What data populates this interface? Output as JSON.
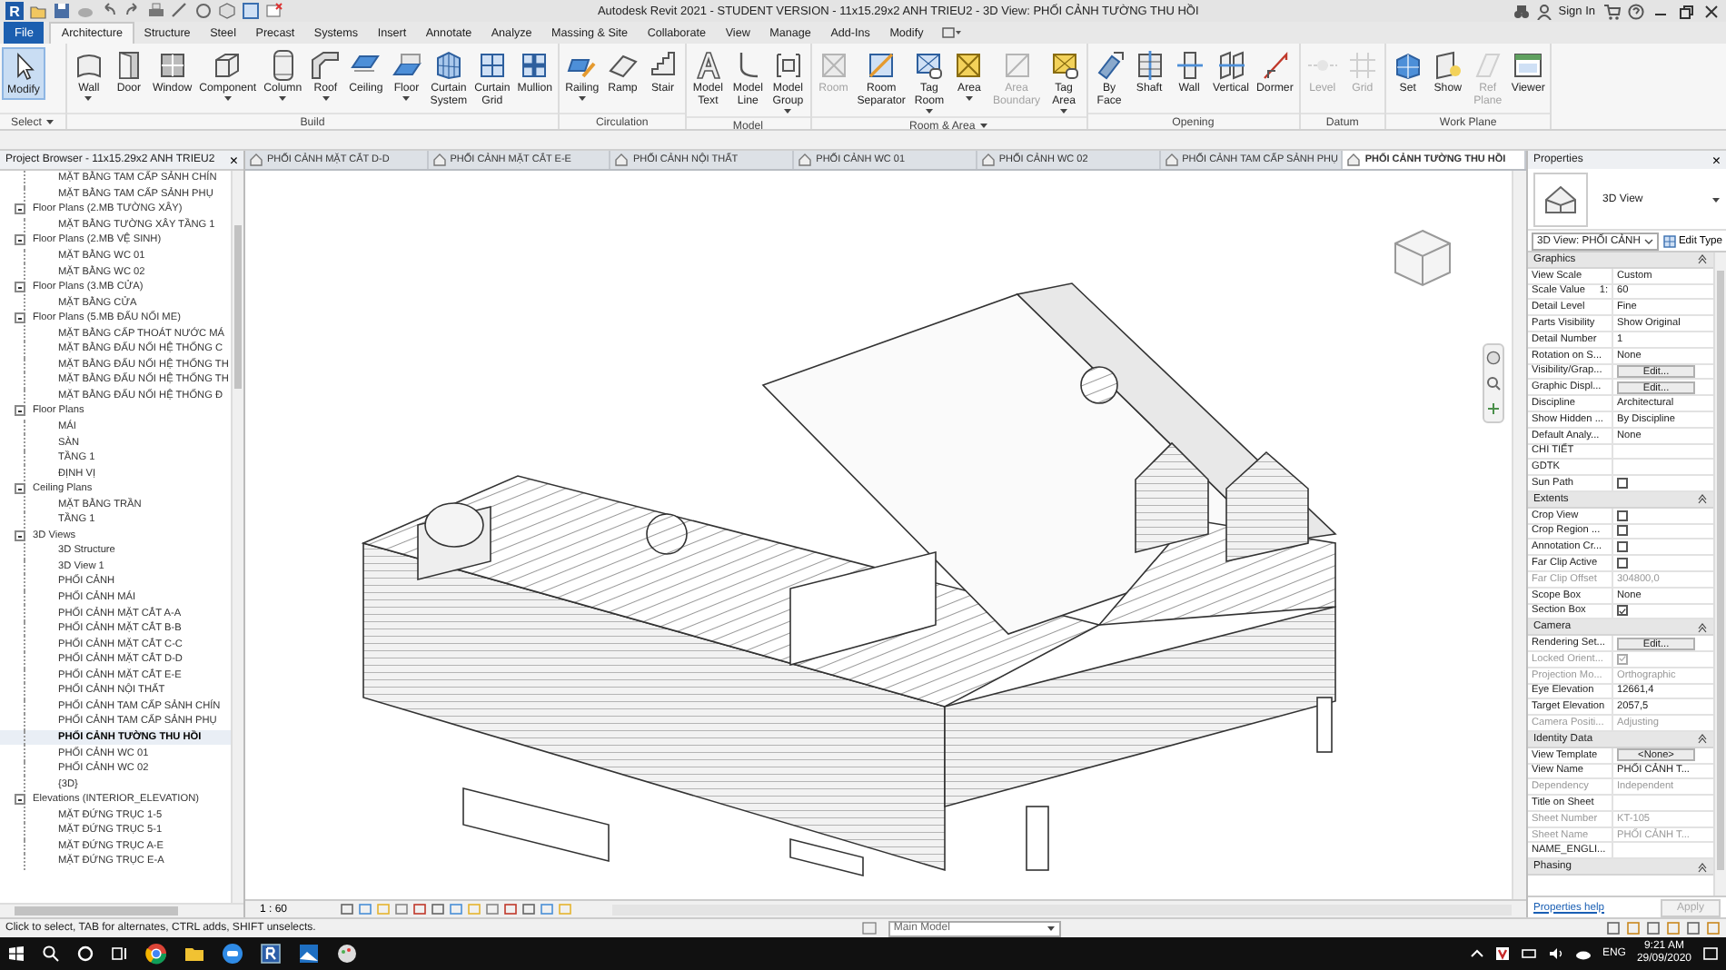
{
  "title_bar": {
    "app_logo": "R",
    "title": "Autodesk Revit 2021 - STUDENT VERSION - 11x15.29x2 ANH TRIEU2 - 3D View: PHỐI CẢNH TƯỜNG THU HỒI",
    "sign_in": "Sign In"
  },
  "ribbon": {
    "file_tab": "File",
    "tabs": [
      {
        "label": "Architecture",
        "selected": true
      },
      {
        "label": "Structure",
        "selected": false
      },
      {
        "label": "Steel",
        "selected": false
      },
      {
        "label": "Precast",
        "selected": false
      },
      {
        "label": "Systems",
        "selected": false
      },
      {
        "label": "Insert",
        "selected": false
      },
      {
        "label": "Annotate",
        "selected": false
      },
      {
        "label": "Analyze",
        "selected": false
      },
      {
        "label": "Massing & Site",
        "selected": false
      },
      {
        "label": "Collaborate",
        "selected": false
      },
      {
        "label": "View",
        "selected": false
      },
      {
        "label": "Manage",
        "selected": false
      },
      {
        "label": "Add-Ins",
        "selected": false
      },
      {
        "label": "Modify",
        "selected": false
      }
    ],
    "panels": [
      {
        "title": "Select",
        "has_menu": true,
        "tools": [
          {
            "label": "Modify",
            "active": true,
            "disabled": false
          }
        ]
      },
      {
        "title": "Build",
        "tools": [
          {
            "label": "Wall",
            "has_menu": true,
            "active": false,
            "disabled": false
          },
          {
            "label": "Door",
            "active": false,
            "disabled": false
          },
          {
            "label": "Window",
            "active": false,
            "disabled": false
          },
          {
            "label": "Component",
            "has_menu": true,
            "active": false,
            "disabled": false
          },
          {
            "label": "Column",
            "has_menu": true,
            "active": false,
            "disabled": false
          },
          {
            "label": "Roof",
            "has_menu": true,
            "active": false,
            "disabled": false
          },
          {
            "label": "Ceiling",
            "active": false,
            "disabled": false
          },
          {
            "label": "Floor",
            "has_menu": true,
            "active": false,
            "disabled": false
          },
          {
            "label": "Curtain System",
            "active": false,
            "disabled": false
          },
          {
            "label": "Curtain Grid",
            "active": false,
            "disabled": false
          },
          {
            "label": "Mullion",
            "active": false,
            "disabled": false
          }
        ]
      },
      {
        "title": "Circulation",
        "tools": [
          {
            "label": "Railing",
            "has_menu": true,
            "active": false,
            "disabled": false
          },
          {
            "label": "Ramp",
            "active": false,
            "disabled": false
          },
          {
            "label": "Stair",
            "active": false,
            "disabled": false
          }
        ]
      },
      {
        "title": "Model",
        "tools": [
          {
            "label": "Model Text",
            "active": false,
            "disabled": false
          },
          {
            "label": "Model Line",
            "active": false,
            "disabled": false
          },
          {
            "label": "Model Group",
            "has_menu": true,
            "active": false,
            "disabled": false
          }
        ]
      },
      {
        "title": "Room & Area",
        "has_menu": true,
        "tools": [
          {
            "label": "Room",
            "active": false,
            "disabled": true
          },
          {
            "label": "Room Separator",
            "active": false,
            "disabled": false
          },
          {
            "label": "Tag Room",
            "has_menu": true,
            "active": false,
            "disabled": false
          },
          {
            "label": "Area",
            "has_menu": true,
            "active": false,
            "disabled": false
          },
          {
            "label": "Area Boundary",
            "active": false,
            "disabled": true
          },
          {
            "label": "Tag Area",
            "has_menu": true,
            "active": false,
            "disabled": false
          }
        ]
      },
      {
        "title": "Opening",
        "tools": [
          {
            "label": "By Face",
            "active": false,
            "disabled": false
          },
          {
            "label": "Shaft",
            "active": false,
            "disabled": false
          },
          {
            "label": "Wall",
            "active": false,
            "disabled": false
          },
          {
            "label": "Vertical",
            "active": false,
            "disabled": false
          },
          {
            "label": "Dormer",
            "active": false,
            "disabled": false
          }
        ]
      },
      {
        "title": "Datum",
        "tools": [
          {
            "label": "Level",
            "active": false,
            "disabled": true
          },
          {
            "label": "Grid",
            "active": false,
            "disabled": true
          }
        ]
      },
      {
        "title": "Work Plane",
        "tools": [
          {
            "label": "Set",
            "active": false,
            "disabled": false
          },
          {
            "label": "Show",
            "active": false,
            "disabled": false
          },
          {
            "label": "Ref Plane",
            "active": false,
            "disabled": true
          },
          {
            "label": "Viewer",
            "active": false,
            "disabled": false
          }
        ]
      }
    ]
  },
  "project_browser": {
    "title": "Project Browser - 11x15.29x2 ANH TRIEU2",
    "close": "×",
    "items": [
      {
        "label": "MẶT BẰNG TAM CẤP SẢNH CHÍN",
        "selected": false
      },
      {
        "label": "MẶT BẰNG TAM CẤP SẢNH PHỤ",
        "selected": false
      },
      {
        "label": "Floor Plans (2.MB TƯỜNG XÂY)",
        "selected": false,
        "expanded": true,
        "children": [
          {
            "label": "MẶT BẰNG TƯỜNG XÂY TẦNG 1",
            "selected": false
          }
        ]
      },
      {
        "label": "Floor Plans (2.MB VỆ SINH)",
        "selected": false,
        "expanded": true,
        "children": [
          {
            "label": "MẶT BẰNG WC 01",
            "selected": false
          },
          {
            "label": "MẶT BẰNG WC 02",
            "selected": false
          }
        ]
      },
      {
        "label": "Floor Plans (3.MB CỬA)",
        "selected": false,
        "expanded": true,
        "children": [
          {
            "label": "MẶT BẰNG CỬA",
            "selected": false
          }
        ]
      },
      {
        "label": "Floor Plans (5.MB ĐẤU NỐI ME)",
        "selected": false,
        "expanded": true,
        "children": [
          {
            "label": "MẶT BẰNG CẤP THOÁT NƯỚC MÁ",
            "selected": false
          },
          {
            "label": "MẶT BẰNG ĐẤU NỐI HỆ THỐNG C",
            "selected": false
          },
          {
            "label": "MẶT BẰNG ĐẤU NỐI HỆ THỐNG TH",
            "selected": false
          },
          {
            "label": "MẶT BẰNG ĐẤU NỐI HỆ THỐNG TH",
            "selected": false
          },
          {
            "label": "MẶT BẰNG ĐẤU NỐI HỆ THỐNG Đ",
            "selected": false
          }
        ]
      },
      {
        "label": "Floor Plans",
        "selected": false,
        "expanded": true,
        "children": [
          {
            "label": "MÁI",
            "selected": false
          },
          {
            "label": "SÀN",
            "selected": false
          },
          {
            "label": "TẦNG 1",
            "selected": false
          },
          {
            "label": "ĐỊNH VỊ",
            "selected": false
          }
        ]
      },
      {
        "label": "Ceiling Plans",
        "selected": false,
        "expanded": true,
        "children": [
          {
            "label": "MẶT BẰNG TRẦN",
            "selected": false
          },
          {
            "label": "TẦNG 1",
            "selected": false
          }
        ]
      },
      {
        "label": "3D Views",
        "selected": false,
        "expanded": true,
        "children": [
          {
            "label": "3D Structure",
            "selected": false
          },
          {
            "label": "3D View 1",
            "selected": false
          },
          {
            "label": "PHỐI CẢNH",
            "selected": false
          },
          {
            "label": "PHỐI CẢNH MÁI",
            "selected": false
          },
          {
            "label": "PHỐI CẢNH MẶT CẮT A-A",
            "selected": false
          },
          {
            "label": "PHỐI CẢNH MẶT CẮT B-B",
            "selected": false
          },
          {
            "label": "PHỐI CẢNH MẶT CẮT C-C",
            "selected": false
          },
          {
            "label": "PHỐI CẢNH MẶT CẮT D-D",
            "selected": false
          },
          {
            "label": "PHỐI CẢNH MẶT CẮT E-E",
            "selected": false
          },
          {
            "label": "PHỐI CẢNH NỘI THẤT",
            "selected": false
          },
          {
            "label": "PHỐI CẢNH TAM CẤP SẢNH CHÍN",
            "selected": false
          },
          {
            "label": "PHỐI CẢNH TAM CẤP SẢNH PHỤ",
            "selected": false
          },
          {
            "label": "PHỐI CẢNH TƯỜNG THU HỒI",
            "selected": true
          },
          {
            "label": "PHỐI CẢNH WC 01",
            "selected": false
          },
          {
            "label": "PHỐI CẢNH WC 02",
            "selected": false
          },
          {
            "label": "{3D}",
            "selected": false
          }
        ]
      },
      {
        "label": "Elevations (INTERIOR_ELEVATION)",
        "selected": false,
        "expanded": true,
        "children": [
          {
            "label": "MẶT ĐỨNG TRỤC 1-5",
            "selected": false
          },
          {
            "label": "MẶT ĐỨNG TRỤC 5-1",
            "selected": false
          },
          {
            "label": "MẶT ĐỨNG TRỤC A-E",
            "selected": false
          },
          {
            "label": "MẶT ĐỨNG TRỤC E-A",
            "selected": false
          }
        ]
      }
    ]
  },
  "view_tabs": [
    {
      "label": "PHỐI CẢNH MẶT CẮT D-D",
      "selected": false
    },
    {
      "label": "PHỐI CẢNH MẶT CẮT E-E",
      "selected": false
    },
    {
      "label": "PHỐI CẢNH NỘI THẤT",
      "selected": false
    },
    {
      "label": "PHỐI CẢNH WC 01",
      "selected": false
    },
    {
      "label": "PHỐI CẢNH WC 02",
      "selected": false
    },
    {
      "label": "PHỐI CẢNH TAM CẤP SẢNH PHỤ",
      "selected": false
    },
    {
      "label": "PHỐI CẢNH TƯỜNG THU HỒI",
      "selected": true
    }
  ],
  "view": {
    "scale": "1 : 60"
  },
  "properties": {
    "title": "Properties",
    "close": "×",
    "type_name": "3D View",
    "view_selector": "3D View: PHỐI CẢNH",
    "edit_type": "Edit Type",
    "groups": [
      {
        "name": "Graphics",
        "expanded": true,
        "rows": [
          {
            "label": "View Scale",
            "kind": "text",
            "value": "Custom",
            "disabled": false
          },
          {
            "label": "Scale Value",
            "unit": "1:",
            "kind": "text",
            "value": "60",
            "disabled": false
          },
          {
            "label": "Detail Level",
            "kind": "text",
            "value": "Fine",
            "disabled": false
          },
          {
            "label": "Parts Visibility",
            "kind": "text",
            "value": "Show Original",
            "disabled": false
          },
          {
            "label": "Detail Number",
            "kind": "text",
            "value": "1",
            "disabled": false
          },
          {
            "label": "Rotation on S...",
            "kind": "text",
            "value": "None",
            "disabled": false
          },
          {
            "label": "Visibility/Grap...",
            "kind": "button",
            "value": "Edit...",
            "disabled": false
          },
          {
            "label": "Graphic Displ...",
            "kind": "button",
            "value": "Edit...",
            "disabled": false
          },
          {
            "label": "Discipline",
            "kind": "text",
            "value": "Architectural",
            "disabled": false
          },
          {
            "label": "Show Hidden ...",
            "kind": "text",
            "value": "By Discipline",
            "disabled": false
          },
          {
            "label": "Default Analy...",
            "kind": "text",
            "value": "None",
            "disabled": false
          },
          {
            "label": "CHI TIẾT",
            "kind": "text",
            "disabled": false
          },
          {
            "label": "GDTK",
            "kind": "text",
            "disabled": false
          },
          {
            "label": "Sun Path",
            "kind": "check",
            "checked": false,
            "disabled": false
          }
        ]
      },
      {
        "name": "Extents",
        "expanded": true,
        "rows": [
          {
            "label": "Crop View",
            "kind": "check",
            "checked": false,
            "disabled": false
          },
          {
            "label": "Crop Region ...",
            "kind": "check",
            "checked": false,
            "disabled": false
          },
          {
            "label": "Annotation Cr...",
            "kind": "check",
            "checked": false,
            "disabled": false
          },
          {
            "label": "Far Clip Active",
            "kind": "check",
            "checked": false,
            "disabled": false
          },
          {
            "label": "Far Clip Offset",
            "kind": "text",
            "value": "304800,0",
            "disabled": true
          },
          {
            "label": "Scope Box",
            "kind": "text",
            "value": "None",
            "disabled": false
          },
          {
            "label": "Section Box",
            "kind": "check",
            "checked": true,
            "disabled": false
          }
        ]
      },
      {
        "name": "Camera",
        "expanded": true,
        "rows": [
          {
            "label": "Rendering Set...",
            "kind": "button",
            "value": "Edit...",
            "disabled": false
          },
          {
            "label": "Locked Orient...",
            "kind": "check",
            "checked": true,
            "disabled": true
          },
          {
            "label": "Projection Mo...",
            "kind": "text",
            "value": "Orthographic",
            "disabled": true
          },
          {
            "label": "Eye Elevation",
            "kind": "text",
            "value": "12661,4",
            "disabled": false
          },
          {
            "label": "Target Elevation",
            "kind": "text",
            "value": "2057,5",
            "disabled": false
          },
          {
            "label": "Camera Positi...",
            "kind": "text",
            "value": "Adjusting",
            "disabled": true
          }
        ]
      },
      {
        "name": "Identity Data",
        "expanded": true,
        "rows": [
          {
            "label": "View Template",
            "kind": "button",
            "value": "<None>",
            "disabled": false
          },
          {
            "label": "View Name",
            "kind": "text",
            "value": "PHỐI CẢNH T...",
            "disabled": false
          },
          {
            "label": "Dependency",
            "kind": "text",
            "value": "Independent",
            "disabled": true
          },
          {
            "label": "Title on Sheet",
            "kind": "text",
            "disabled": false
          },
          {
            "label": "Sheet Number",
            "kind": "text",
            "value": "KT-105",
            "disabled": true
          },
          {
            "label": "Sheet Name",
            "kind": "text",
            "value": "PHỐI CẢNH T...",
            "disabled": true
          },
          {
            "label": "NAME_ENGLI...",
            "kind": "text",
            "disabled": false
          }
        ]
      },
      {
        "name": "Phasing",
        "expanded": true
      }
    ],
    "help_link": "Properties help",
    "apply": "Apply",
    "apply_disabled": true
  },
  "status_bar": {
    "hint": "Click to select, TAB for alternates, CTRL adds, SHIFT unselects.",
    "model": "Main Model"
  },
  "taskbar": {
    "language": "ENG",
    "time": "9:21 AM",
    "date": "29/09/2020"
  }
}
